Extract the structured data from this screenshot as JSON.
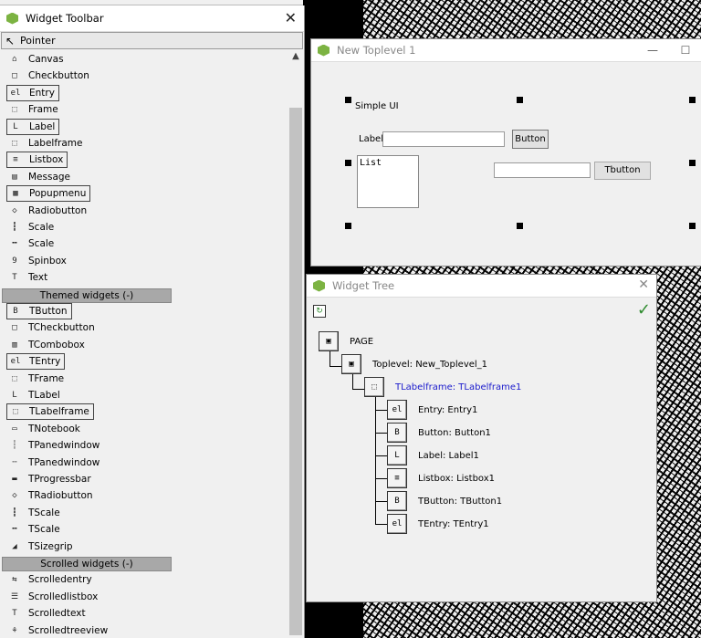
{
  "toolbar": {
    "title": "Widget Toolbar",
    "close": "✕",
    "pointer_label": "Pointer",
    "tk_widgets": [
      {
        "label": "Canvas",
        "icon": "canvas-icon",
        "glyph": "⌂"
      },
      {
        "label": "Checkbutton",
        "icon": "checkbutton-icon",
        "glyph": "□"
      },
      {
        "label": "Entry",
        "icon": "entry-icon",
        "glyph": "el"
      },
      {
        "label": "Frame",
        "icon": "frame-icon",
        "glyph": "⬚"
      },
      {
        "label": "Label",
        "icon": "label-icon",
        "glyph": "L"
      },
      {
        "label": "Labelframe",
        "icon": "labelframe-icon",
        "glyph": "⬚"
      },
      {
        "label": "Listbox",
        "icon": "listbox-icon",
        "glyph": "≡"
      },
      {
        "label": "Message",
        "icon": "message-icon",
        "glyph": "▤"
      },
      {
        "label": "Popupmenu",
        "icon": "popupmenu-icon",
        "glyph": "▦"
      },
      {
        "label": "Radiobutton",
        "icon": "radiobutton-icon",
        "glyph": "◇"
      },
      {
        "label": "Scale",
        "icon": "vertical-scale-icon",
        "glyph": "┇"
      },
      {
        "label": "Scale",
        "icon": "horizontal-scale-icon",
        "glyph": "╍"
      },
      {
        "label": "Spinbox",
        "icon": "spinbox-icon",
        "glyph": "9"
      },
      {
        "label": "Text",
        "icon": "text-icon",
        "glyph": "T"
      }
    ],
    "themed_header": "Themed widgets (-)",
    "themed_widgets": [
      {
        "label": "TButton",
        "icon": "tbutton-icon",
        "glyph": "B"
      },
      {
        "label": "TCheckbutton",
        "icon": "tcheckbutton-icon",
        "glyph": "□"
      },
      {
        "label": "TCombobox",
        "icon": "tcombobox-icon",
        "glyph": "▥"
      },
      {
        "label": "TEntry",
        "icon": "tentry-icon",
        "glyph": "el"
      },
      {
        "label": "TFrame",
        "icon": "tframe-icon",
        "glyph": "⬚"
      },
      {
        "label": "TLabel",
        "icon": "tlabel-icon",
        "glyph": "L"
      },
      {
        "label": "TLabelframe",
        "icon": "tlabelframe-icon",
        "glyph": "⬚"
      },
      {
        "label": "TNotebook",
        "icon": "tnotebook-icon",
        "glyph": "▭"
      },
      {
        "label": "TPanedwindow",
        "icon": "vertical-panedwindow-icon",
        "glyph": "┆"
      },
      {
        "label": "TPanedwindow",
        "icon": "horizontal-panedwindow-icon",
        "glyph": "╌"
      },
      {
        "label": "TProgressbar",
        "icon": "tprogressbar-icon",
        "glyph": "▬"
      },
      {
        "label": "TRadiobutton",
        "icon": "tradiobutton-icon",
        "glyph": "◇"
      },
      {
        "label": "TScale",
        "icon": "vertical-tscale-icon",
        "glyph": "┇"
      },
      {
        "label": "TScale",
        "icon": "horizontal-tscale-icon",
        "glyph": "╍"
      },
      {
        "label": "TSizegrip",
        "icon": "tsizegrip-icon",
        "glyph": "◢"
      }
    ],
    "scrolled_header": "Scrolled widgets (-)",
    "scrolled_widgets": [
      {
        "label": "Scrolledentry",
        "icon": "scrolledentry-icon",
        "glyph": "⇆"
      },
      {
        "label": "Scrolledlistbox",
        "icon": "scrolledlistbox-icon",
        "glyph": "☰"
      },
      {
        "label": "Scrolledtext",
        "icon": "scrolledtext-icon",
        "glyph": "T"
      },
      {
        "label": "Scrolledtreeview",
        "icon": "scrolledtreeview-icon",
        "glyph": "⚘"
      }
    ]
  },
  "toplevel": {
    "title": "New Toplevel 1",
    "minimize": "—",
    "maximize": "☐",
    "simple_ui": "Simple UI",
    "label_text": "Label",
    "button_text": "Button",
    "listbox_item": "List",
    "tbutton_text": "Tbutton"
  },
  "tree": {
    "title": "Widget Tree",
    "close": "✕",
    "refresh": "↻",
    "check": "✓",
    "nodes": [
      {
        "label": "PAGE",
        "glyph": "▣"
      },
      {
        "label": "Toplevel: New_Toplevel_1",
        "glyph": "▣"
      },
      {
        "label": "TLabelframe: TLabelframe1",
        "glyph": "⬚"
      },
      {
        "label": "Entry: Entry1",
        "glyph": "el"
      },
      {
        "label": "Button: Button1",
        "glyph": "B"
      },
      {
        "label": "Label: Label1",
        "glyph": "L"
      },
      {
        "label": "Listbox: Listbox1",
        "glyph": "≡"
      },
      {
        "label": "TButton: TButton1",
        "glyph": "B"
      },
      {
        "label": "TEntry: TEntry1",
        "glyph": "el"
      }
    ]
  },
  "colors": {
    "selected_node": "#1a1acc",
    "check": "#2e8b2e",
    "app_icon": "#7cb342"
  }
}
